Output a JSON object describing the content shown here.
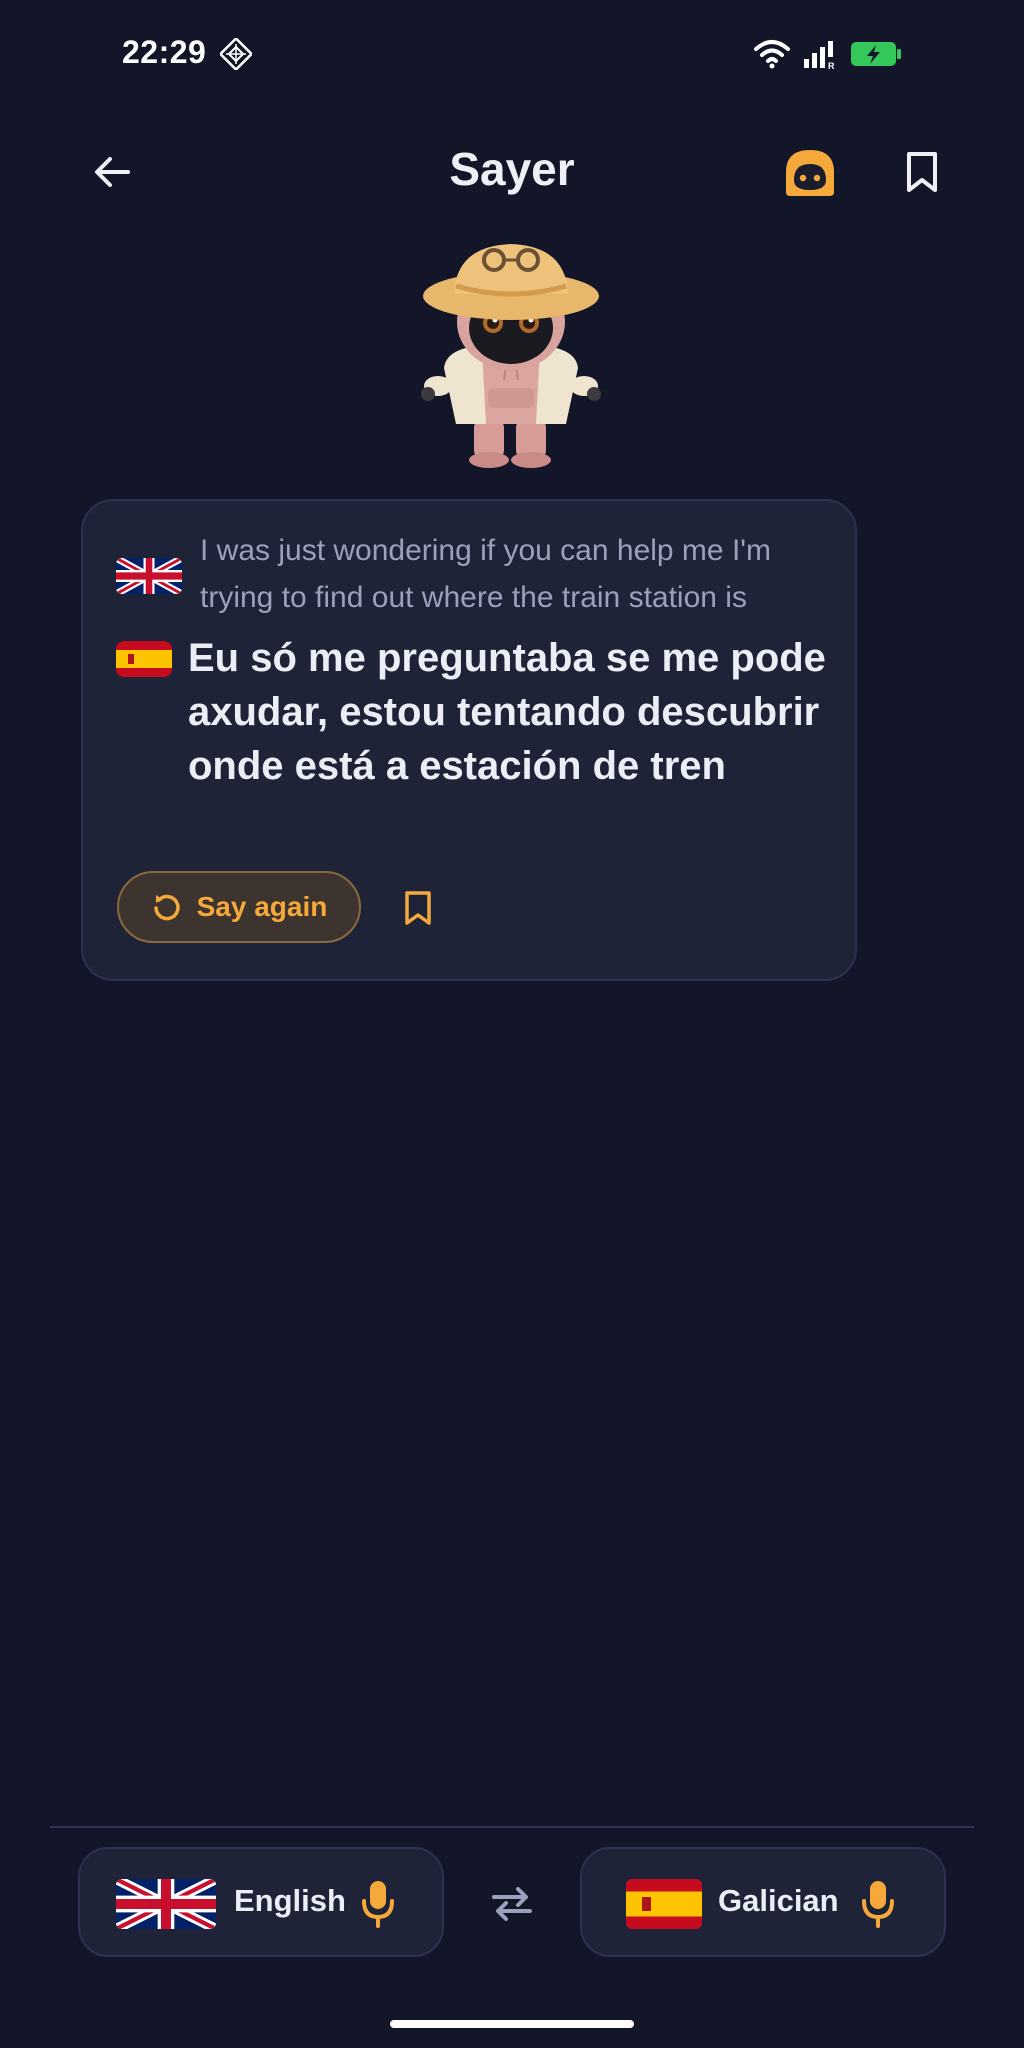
{
  "status_bar": {
    "time": "22:29",
    "icons": [
      "app-notification-icon",
      "wifi-icon",
      "signal-icon",
      "battery-charging-icon"
    ],
    "battery_color": "#34c759"
  },
  "app_bar": {
    "title": "Sayer",
    "icons": [
      "back-arrow-icon",
      "avatar-icon",
      "bookmark-icon"
    ]
  },
  "colors": {
    "background": "#121628",
    "card": "#1e2338",
    "accent": "#f5a93a",
    "muted_text": "#9aa1ba"
  },
  "conversation": {
    "source_flag": "uk-flag-icon",
    "source_text": "I was just wondering if you can help me I'm trying to find out where the train station is",
    "target_flag": "spain-flag-icon",
    "target_text": "Eu só me preguntaba se me pode axudar, estou tentando descubrir onde está a estación de tren",
    "say_again_label": "Say again"
  },
  "language_bar": {
    "left": {
      "flag": "uk-flag-icon",
      "label": "English",
      "mic_icon": "microphone-icon"
    },
    "swap_icon": "swap-arrows-icon",
    "right": {
      "flag": "spain-flag-icon",
      "label": "Galician",
      "mic_icon": "microphone-icon"
    }
  }
}
